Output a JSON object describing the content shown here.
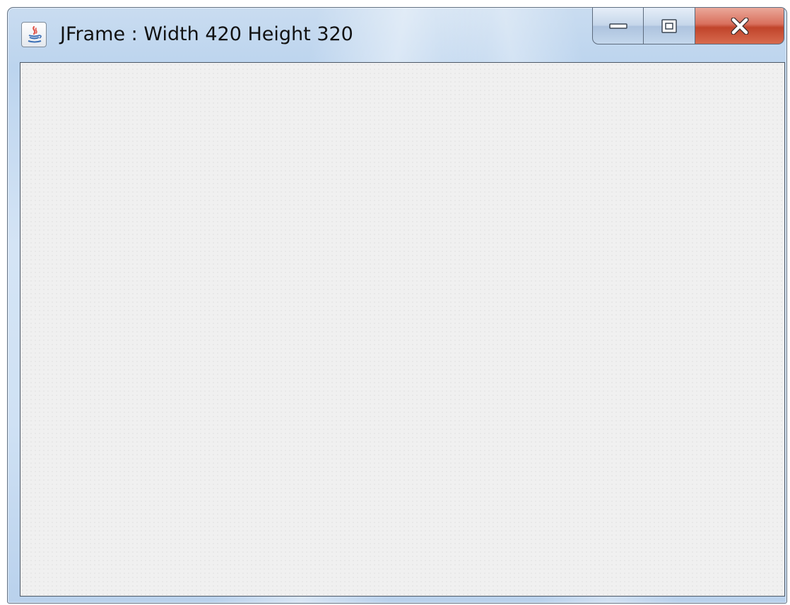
{
  "window": {
    "title": "JFrame : Width 420 Height 320",
    "icon": "java-cup-icon",
    "caption_buttons": {
      "minimize": "minimize-icon",
      "maximize": "maximize-icon",
      "close": "close-icon"
    }
  },
  "colors": {
    "client_background": "#f0f0f0",
    "frame_glass": "#c9dcf0",
    "close_button": "#c7472d"
  }
}
